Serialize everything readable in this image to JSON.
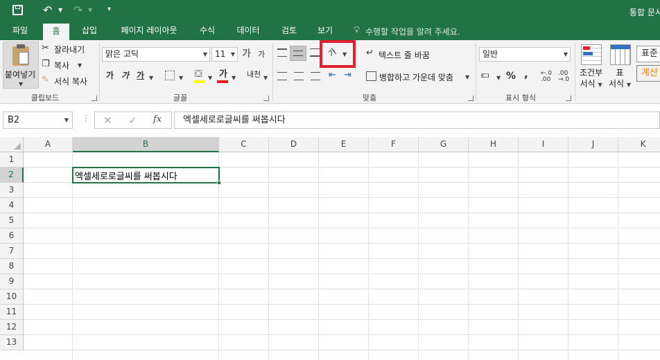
{
  "title_bar": {
    "doc_title": "통합 문서"
  },
  "tabs": [
    {
      "label": "파일",
      "active": false
    },
    {
      "label": "홈",
      "active": true
    },
    {
      "label": "삽입",
      "active": false
    },
    {
      "label": "페이지 레이아웃",
      "active": false
    },
    {
      "label": "수식",
      "active": false
    },
    {
      "label": "데이터",
      "active": false
    },
    {
      "label": "검토",
      "active": false
    },
    {
      "label": "보기",
      "active": false
    }
  ],
  "tell_me": "수행할 작업을 알려 주세요.",
  "clipboard": {
    "paste_label": "붙여넣기",
    "cut_label": "잘라내기",
    "copy_label": "복사",
    "format_painter_label": "서식 복사",
    "group_label": "클립보드"
  },
  "font": {
    "font_name": "맑은 고딕",
    "font_size": "11",
    "bold": "가",
    "italic": "가",
    "underline": "가",
    "font_color_glyph": "가",
    "phonetic_glyph": "내천",
    "grow_glyph": "가",
    "shrink_glyph": "가",
    "group_label": "글꼴",
    "accent_red": "#e51c23",
    "accent_yellow": "#ffff00"
  },
  "alignment": {
    "wrap_text_label": "텍스트 줄 바꿈",
    "merge_center_label": "병합하고 가운데 맞춤",
    "group_label": "맞춤",
    "orientation_glyph": "가",
    "highlight_color": "#e0222e"
  },
  "number": {
    "format_value": "일반",
    "percent": "%",
    "comma": ",",
    "group_label": "표시 형식"
  },
  "styles": {
    "conditional_label_1": "조건부",
    "conditional_label_2": "서식",
    "table_label_1": "표",
    "table_label_2": "서식",
    "style_normal": "표준",
    "style_calc": "계산"
  },
  "formula_bar": {
    "name_box": "B2",
    "fx": "fx",
    "content": "엑셀세로로글씨를 써봅시다"
  },
  "sheet": {
    "columns": [
      "A",
      "B",
      "C",
      "D",
      "E",
      "F",
      "G",
      "H",
      "I",
      "J",
      "K"
    ],
    "rows": [
      "1",
      "2",
      "3",
      "4",
      "5",
      "6",
      "7",
      "8",
      "9",
      "10",
      "11",
      "12",
      "13"
    ],
    "selected_cell": "B2",
    "b2_value": "엑셀세로로글씨를 써봅시다",
    "accent_green": "#217346"
  }
}
